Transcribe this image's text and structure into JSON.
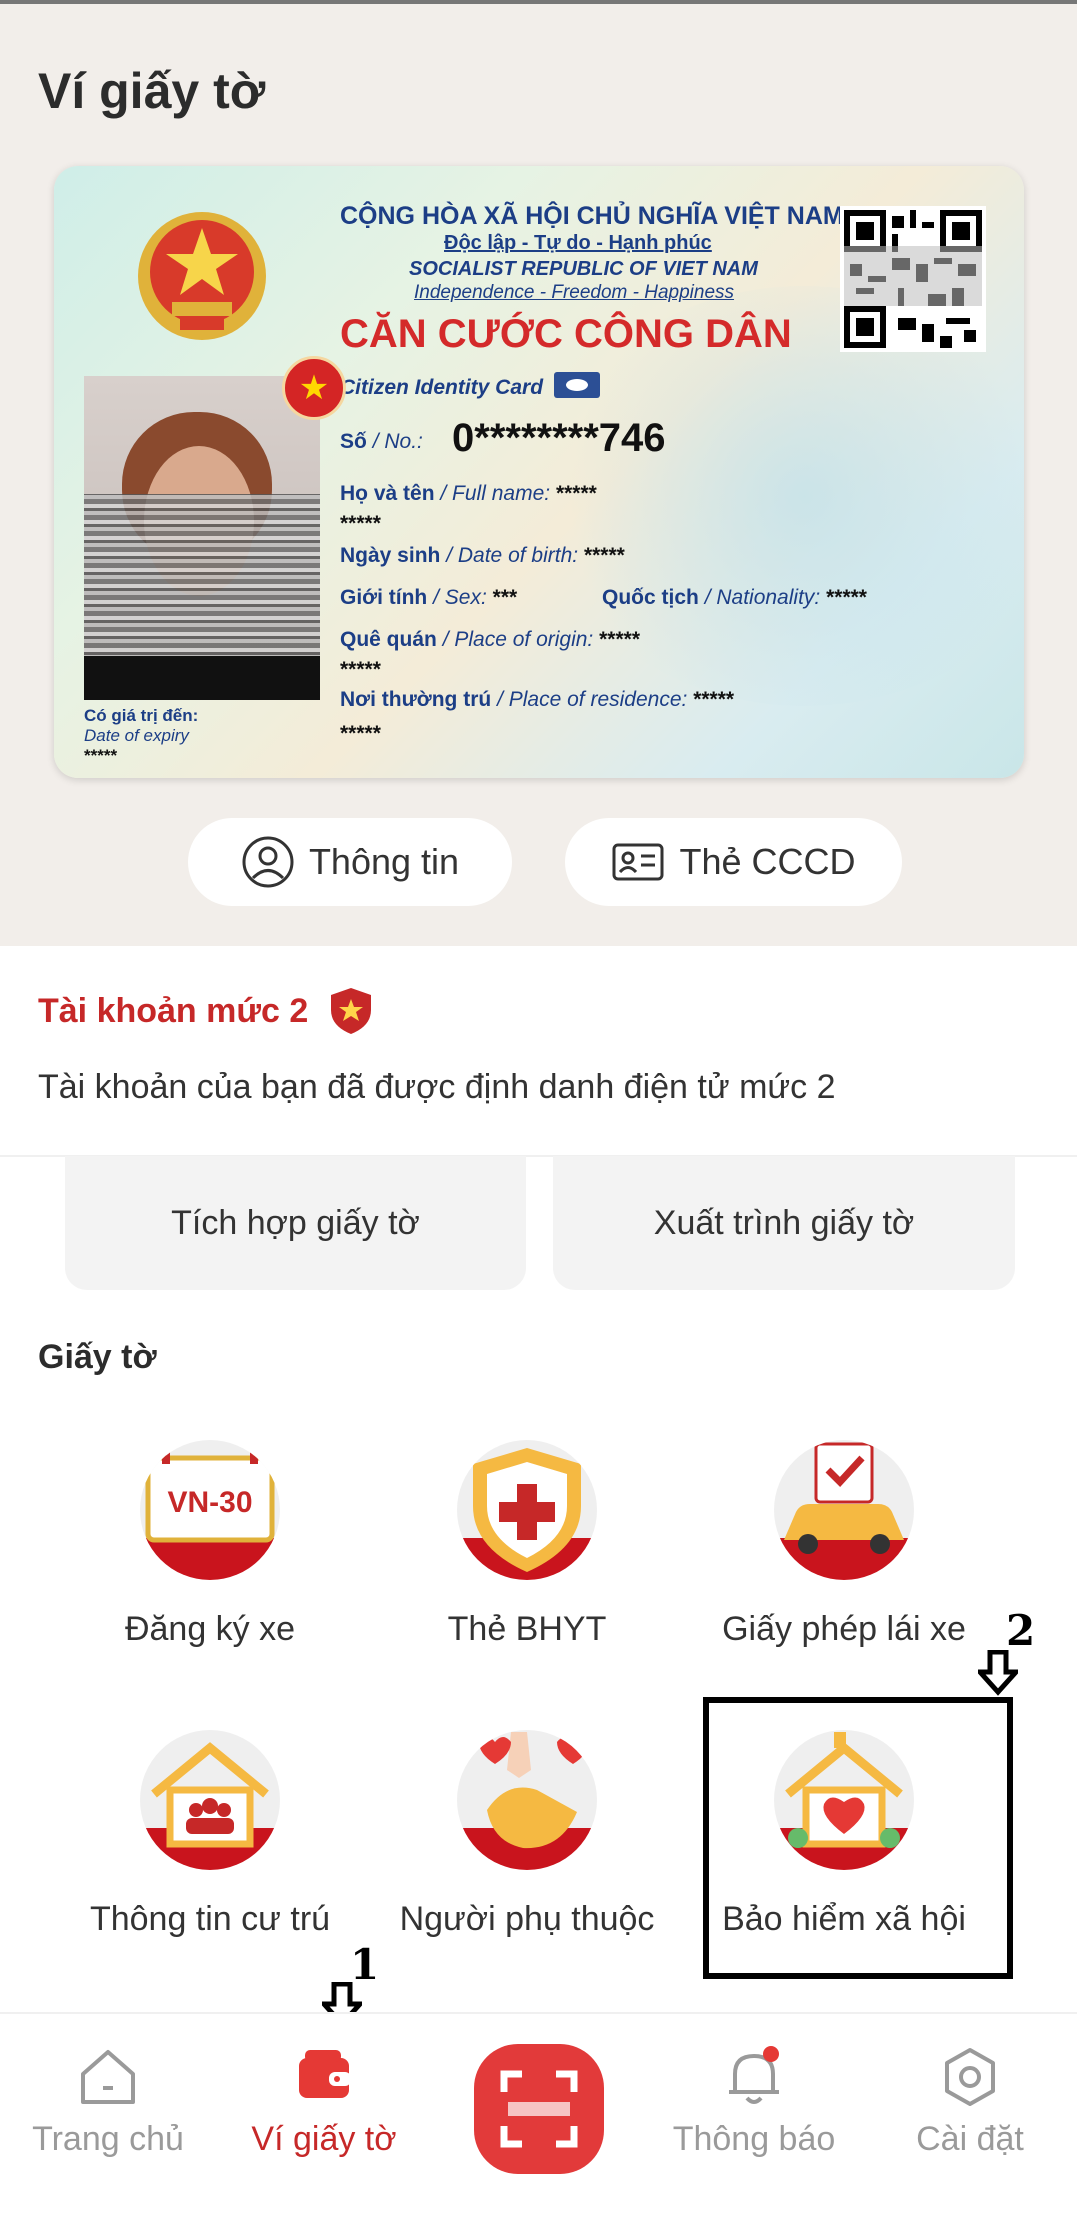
{
  "page": {
    "title": "Ví giấy tờ"
  },
  "id_card": {
    "header_line1": "CỘNG HÒA XÃ HỘI CHỦ NGHĨA VIỆT NAM",
    "header_line2": "Độc lập - Tự do - Hạnh phúc",
    "header_line3": "SOCIALIST REPUBLIC OF VIET NAM",
    "header_line4": "Independence - Freedom - Happiness",
    "card_title": "CĂN CƯỚC CÔNG DÂN",
    "card_subtitle": "Citizen Identity Card",
    "no_label_vi": "Số",
    "no_label_en": "/ No.:",
    "no_value": "0********746",
    "name_label_vi": "Họ và tên",
    "name_label_en": "/ Full name:",
    "name_value": "*****",
    "name_value2": "*****",
    "dob_label_vi": "Ngày sinh",
    "dob_label_en": "/ Date of birth:",
    "dob_value": "*****",
    "sex_label_vi": "Giới tính",
    "sex_label_en": "/ Sex:",
    "sex_value": "***",
    "nat_label_vi": "Quốc tịch",
    "nat_label_en": "/ Nationality:",
    "nat_value": "*****",
    "origin_label_vi": "Quê quán",
    "origin_label_en": "/ Place of origin:",
    "origin_value": "*****",
    "origin_value2": "*****",
    "residence_label_vi": "Nơi thường trú",
    "residence_label_en": "/ Place of residence:",
    "residence_value": "*****",
    "residence_value2": "*****",
    "expiry_label_vi": "Có giá trị đến:",
    "expiry_label_en": "Date of expiry",
    "expiry_value": "*****"
  },
  "card_actions": {
    "info_label": "Thông tin",
    "card_label": "Thẻ CCCD"
  },
  "account": {
    "level_title": "Tài khoản mức 2",
    "level_desc": "Tài khoản của bạn đã được định danh điện tử mức 2"
  },
  "quick_actions": {
    "integrate": "Tích hợp giấy tờ",
    "present": "Xuất trình giấy tờ"
  },
  "documents": {
    "section_title": "Giấy tờ",
    "items": [
      {
        "label": "Đăng ký xe",
        "plate_text": "VN-30"
      },
      {
        "label": "Thẻ BHYT"
      },
      {
        "label": "Giấy phép lái xe"
      },
      {
        "label": "Thông tin cư trú"
      },
      {
        "label": "Người phụ thuộc"
      },
      {
        "label": "Bảo hiểm xã hội"
      }
    ]
  },
  "annotations": {
    "marker1": "1",
    "marker2": "2"
  },
  "nav": {
    "home": "Trang chủ",
    "wallet": "Ví giấy tờ",
    "notifications": "Thông báo",
    "settings": "Cài đặt"
  },
  "colors": {
    "brand_red": "#c62828",
    "nav_inactive": "#9a9a9a",
    "card_blue": "#1c3e86"
  }
}
